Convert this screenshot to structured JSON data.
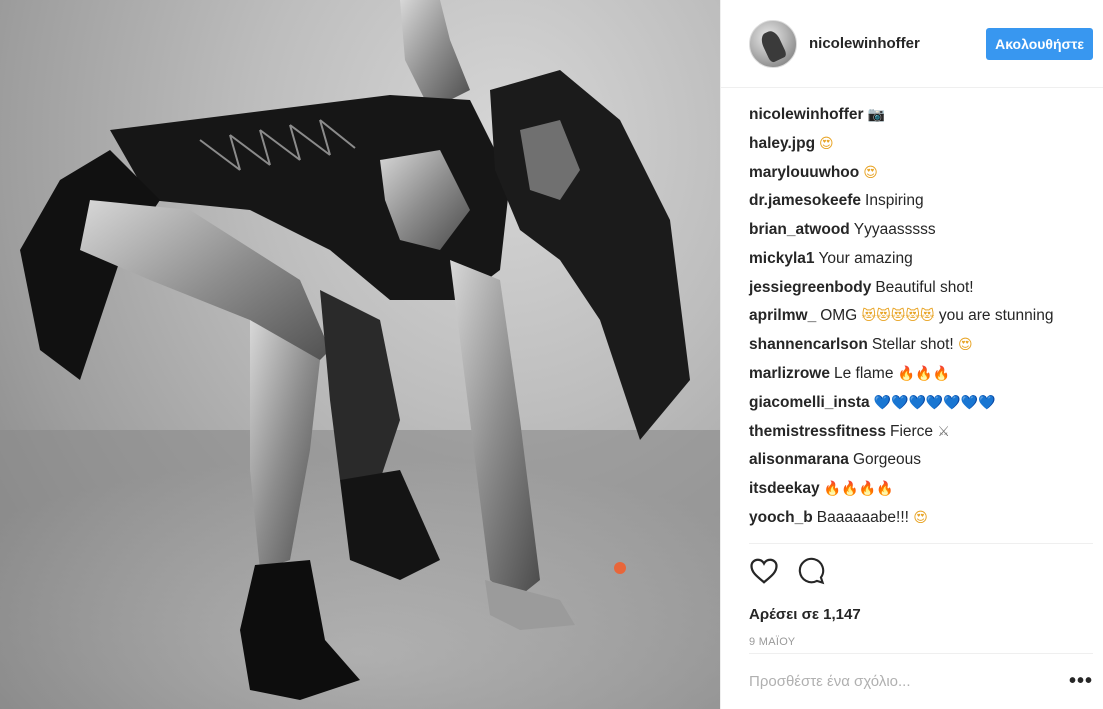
{
  "post": {
    "username": "nicolewinhoffer",
    "follow_label": "Ακολουθήστε",
    "likes_text": "Αρέσει σε 1,147",
    "date_text": "9 ΜΑΪΟΥ",
    "comment_placeholder": "Προσθέστε ένα σχόλιο...",
    "more_label": "•••"
  },
  "comments": [
    {
      "user": "nicolewinhoffer",
      "text": "",
      "emoji": "📷",
      "emoji_class": "g"
    },
    {
      "user": "haley.jpg",
      "text": "",
      "emoji": "😍",
      "emoji_class": "y"
    },
    {
      "user": "marylouuwhoo",
      "text": "",
      "emoji": "😍",
      "emoji_class": "y"
    },
    {
      "user": "dr.jamesokeefe",
      "text": "Inspiring",
      "emoji": "",
      "emoji_class": ""
    },
    {
      "user": "brian_atwood",
      "text": "Yyyaasssss",
      "emoji": "",
      "emoji_class": ""
    },
    {
      "user": "mickyla1",
      "text": "Your amazing",
      "emoji": "",
      "emoji_class": ""
    },
    {
      "user": "jessiegreenbody",
      "text": "Beautiful shot!",
      "emoji": "",
      "emoji_class": ""
    },
    {
      "user": "aprilmw_",
      "text": "OMG",
      "emoji": "😻😻😻😻😻",
      "emoji_class": "y",
      "text_after": "you are stunning"
    },
    {
      "user": "shannencarlson",
      "text": "Stellar shot!",
      "emoji": "😍",
      "emoji_class": "y"
    },
    {
      "user": "marlizrowe",
      "text": "Le flame",
      "emoji": "🔥🔥🔥",
      "emoji_class": "f"
    },
    {
      "user": "giacomelli_insta",
      "text": "",
      "emoji": "💙💙💙💙💙💙💙",
      "emoji_class": "b"
    },
    {
      "user": "themistressfitness",
      "text": "Fierce",
      "emoji": "⚔",
      "emoji_class": "g"
    },
    {
      "user": "alisonmarana",
      "text": "Gorgeous",
      "emoji": "",
      "emoji_class": ""
    },
    {
      "user": "itsdeekay",
      "text": "",
      "emoji": "🔥🔥🔥🔥",
      "emoji_class": "f"
    },
    {
      "user": "yooch_b",
      "text": "Baaaaaabe!!!",
      "emoji": "😍",
      "emoji_class": "y"
    }
  ],
  "icons": {
    "like": "heart-icon",
    "comment": "comment-icon"
  },
  "colors": {
    "follow_button": "#3897f0",
    "text": "#262626",
    "muted": "#999999"
  }
}
